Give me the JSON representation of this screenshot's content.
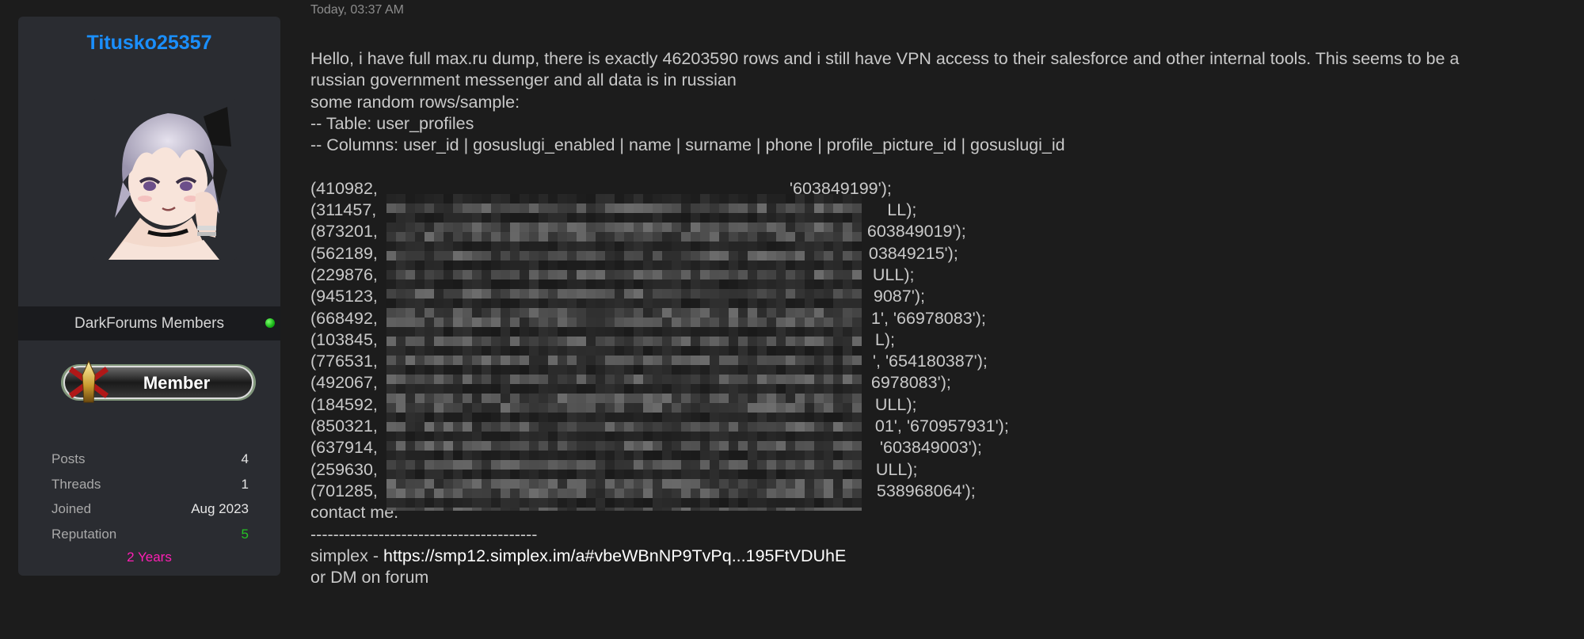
{
  "post": {
    "timestamp": "Today, 03:37 AM",
    "intro_line1": "Hello, i have full max.ru dump, there is exactly 46203590 rows and i still have VPN access to their salesforce and other internal tools. This seems to be a",
    "intro_line2": "russian government messenger and all data is in russian",
    "sample_heading": "some random rows/sample:",
    "table_line": "-- Table: user_profiles",
    "columns_line": "-- Columns: user_id | gosuslugi_enabled | name | surname | phone | profile_picture_id | gosuslugi_id",
    "rows": [
      {
        "start": "(410982,",
        "end": "'603849199');"
      },
      {
        "start": "(311457,",
        "end": "LL);"
      },
      {
        "start": "(873201,",
        "end": "603849019');"
      },
      {
        "start": "(562189,",
        "end": "03849215');"
      },
      {
        "start": "(229876,",
        "end": "ULL);"
      },
      {
        "start": "(945123,",
        "end": "9087');"
      },
      {
        "start": "(668492,",
        "end": "1', '66978083');"
      },
      {
        "start": "(103845,",
        "end": "L);"
      },
      {
        "start": "(776531,",
        "end": "', '654180387');"
      },
      {
        "start": "(492067,",
        "end": "6978083');"
      },
      {
        "start": "(184592,",
        "end": "ULL);"
      },
      {
        "start": "(850321,",
        "end": "01', '670957931');"
      },
      {
        "start": "(637914,",
        "end": "'603849003');"
      },
      {
        "start": "(259630,",
        "end": "ULL);"
      },
      {
        "start": "(701285,",
        "end": "538968064');"
      }
    ],
    "contact_line": "contact me.",
    "divider": "----------------------------------------",
    "simplex_label": "simplex - ",
    "simplex_link": "https://smp12.simplex.im/a#vbeWBnNP9TvPq...195FtVDUhE",
    "dm_line": "or DM on forum"
  },
  "author": {
    "username": "Titusko25357",
    "avatar_icon": "anime-avatar-icon",
    "group": "DarkForums Members",
    "online_status_color": "#17b317",
    "rank_badge_text": "Member",
    "stats": [
      {
        "label": "Posts",
        "value": "4"
      },
      {
        "label": "Threads",
        "value": "1"
      },
      {
        "label": "Joined",
        "value": "Aug 2023"
      },
      {
        "label": "Reputation",
        "value": "5"
      }
    ],
    "member_age": "2 Years"
  },
  "colors": {
    "background": "#1c1c1c",
    "sidebar": "#2a2c31",
    "username": "#1a8fff",
    "reputation": "#25c425",
    "member_age": "#ff1fb5"
  }
}
